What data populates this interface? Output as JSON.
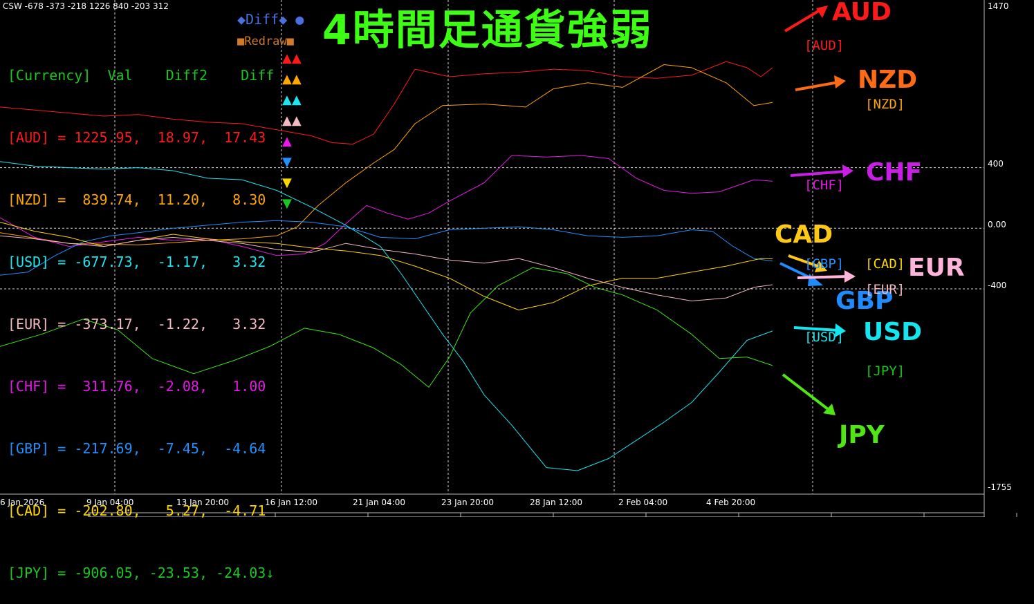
{
  "header": {
    "text": "CSW -678 -373 -218 1226 840 -203 312"
  },
  "title": "4時間足通貨強弱",
  "table": {
    "header": "[Currency]  Val    Diff2    Diff",
    "header_color": "#19c81e",
    "rows": [
      {
        "text": "[AUD] = 1225.95,  18.97,  17.43",
        "color": "#ff1a1a",
        "tri": "▲▲",
        "tri_color": "#ff1a1a"
      },
      {
        "text": "[NZD] =  839.74,  11.20,   8.30",
        "color": "#ffa500",
        "tri": "▲▲",
        "tri_color": "#ffa500"
      },
      {
        "text": "[USD] = -677.73,  -1.17,   3.32",
        "color": "#1ee6f0",
        "tri": "▲▲",
        "tri_color": "#1ee6f0"
      },
      {
        "text": "[EUR] = -373.17,  -1.22,   3.32",
        "color": "#f5b9c0",
        "tri": "▲▲",
        "tri_color": "#f5b9c0"
      },
      {
        "text": "[CHF] =  311.76,  -2.08,   1.00",
        "color": "#e619e6",
        "tri": "▲",
        "tri_color": "#e619e6"
      },
      {
        "text": "[GBP] = -217.69,  -7.45,  -4.64",
        "color": "#1e90ff",
        "tri": "▼",
        "tri_color": "#1e90ff"
      },
      {
        "text": "[CAD] = -202.80,   5.27,  -4.71",
        "color": "#ffd700",
        "tri": "▼",
        "tri_color": "#ffd700"
      },
      {
        "text": "[JPY] = -906.05, -23.53, -24.03↓",
        "color": "#19c81e",
        "tri": "▼",
        "tri_color": "#19c81e"
      }
    ]
  },
  "buttons": {
    "diff": "◆Diff◆ ●",
    "redraw": "■Redraw■"
  },
  "labels": [
    {
      "name": "AUD",
      "color": "#ff1a1a"
    },
    {
      "name": "NZD",
      "color": "#ff6a14"
    },
    {
      "name": "CHF",
      "color": "#c81ee6"
    },
    {
      "name": "CAD",
      "color": "#ffc814"
    },
    {
      "name": "EUR",
      "color": "#ffb4dc"
    },
    {
      "name": "GBP",
      "color": "#1e8cff"
    },
    {
      "name": "USD",
      "color": "#14e6f0"
    },
    {
      "name": "JPY",
      "color": "#50e614"
    }
  ],
  "tags": [
    "[AUD]",
    "[NZD]",
    "[CHF]",
    "[GBP]",
    "[CAD]",
    "[EUR]",
    "[USD]",
    "[JPY]"
  ],
  "chart_data": {
    "type": "line",
    "ylim": [
      -1755,
      1470
    ],
    "y_ticks": [
      "1470",
      "400",
      "0.00",
      "-400",
      "-1755"
    ],
    "x_ticks": [
      "6 Jan 2026",
      "9 Jan 04:00",
      "13 Jan 20:00",
      "16 Jan 12:00",
      "21 Jan 04:00",
      "23 Jan 20:00",
      "28 Jan 12:00",
      "2 Feb 04:00",
      "4 Feb 20:00"
    ],
    "grid": true,
    "series": [
      {
        "name": "AUD",
        "color": "#ff1a1a",
        "x": [
          0,
          50,
          100,
          150,
          200,
          250,
          300,
          350,
          400,
          450,
          480,
          510,
          540,
          570,
          600,
          650,
          700,
          750,
          800,
          850,
          900,
          950,
          1000,
          1050,
          1080,
          1100,
          1117
        ],
        "y": [
          800,
          780,
          760,
          740,
          750,
          720,
          700,
          690,
          650,
          610,
          565,
          555,
          620,
          820,
          1050,
          1000,
          1020,
          1030,
          1050,
          1040,
          1000,
          990,
          1010,
          1100,
          1060,
          1000,
          1060
        ]
      },
      {
        "name": "NZD",
        "color": "#ffa500",
        "x": [
          0,
          100,
          200,
          300,
          350,
          400,
          430,
          460,
          500,
          540,
          570,
          600,
          640,
          700,
          760,
          800,
          850,
          900,
          960,
          1000,
          1050,
          1090,
          1117
        ],
        "y": [
          -30,
          -100,
          -110,
          -80,
          -70,
          -50,
          10,
          150,
          300,
          430,
          520,
          690,
          810,
          820,
          800,
          920,
          960,
          930,
          1080,
          1060,
          960,
          810,
          830
        ]
      },
      {
        "name": "CHF",
        "color": "#e619e6",
        "x": [
          0,
          50,
          100,
          150,
          200,
          250,
          300,
          350,
          400,
          440,
          470,
          500,
          530,
          560,
          590,
          620,
          650,
          700,
          740,
          790,
          840,
          880,
          920,
          960,
          1000,
          1040,
          1090,
          1117
        ],
        "y": [
          70,
          -60,
          -120,
          -90,
          -60,
          -80,
          -70,
          -120,
          -180,
          -170,
          -100,
          30,
          150,
          100,
          60,
          100,
          180,
          300,
          480,
          470,
          480,
          460,
          330,
          250,
          230,
          240,
          320,
          310
        ]
      },
      {
        "name": "GBP",
        "color": "#1e90ff",
        "x": [
          0,
          40,
          80,
          120,
          160,
          200,
          250,
          300,
          350,
          400,
          450,
          500,
          550,
          600,
          650,
          700,
          750,
          800,
          850,
          900,
          950,
          1000,
          1030,
          1060,
          1090,
          1117
        ],
        "y": [
          -310,
          -290,
          -180,
          -90,
          -50,
          -30,
          0,
          20,
          40,
          50,
          40,
          10,
          -60,
          -70,
          -10,
          0,
          10,
          -10,
          -50,
          -60,
          -50,
          -10,
          -20,
          -120,
          -200,
          -217
        ]
      },
      {
        "name": "CAD",
        "color": "#ffd700",
        "x": [
          0,
          50,
          100,
          150,
          200,
          250,
          300,
          350,
          400,
          450,
          500,
          550,
          600,
          650,
          700,
          750,
          800,
          850,
          900,
          950,
          1000,
          1050,
          1100,
          1117
        ],
        "y": [
          40,
          -20,
          -60,
          -120,
          -80,
          -40,
          -70,
          -90,
          -100,
          -130,
          -150,
          -180,
          -250,
          -330,
          -450,
          -540,
          -490,
          -380,
          -330,
          -330,
          -290,
          -250,
          -200,
          -202
        ]
      },
      {
        "name": "EUR",
        "color": "#f5b9c0",
        "x": [
          0,
          50,
          100,
          150,
          200,
          250,
          300,
          350,
          400,
          450,
          500,
          550,
          600,
          650,
          700,
          750,
          800,
          850,
          900,
          950,
          1000,
          1050,
          1090,
          1117
        ],
        "y": [
          -50,
          -70,
          -100,
          -120,
          -80,
          -60,
          -80,
          -100,
          -140,
          -160,
          -100,
          -140,
          -170,
          -210,
          -230,
          -200,
          -260,
          -330,
          -390,
          -440,
          -480,
          -460,
          -390,
          -373
        ]
      },
      {
        "name": "USD",
        "color": "#1ee6f0",
        "x": [
          0,
          50,
          100,
          150,
          200,
          250,
          300,
          350,
          400,
          450,
          500,
          550,
          580,
          610,
          640,
          670,
          700,
          740,
          790,
          835,
          880,
          920,
          960,
          1000,
          1040,
          1080,
          1117
        ],
        "y": [
          440,
          410,
          400,
          390,
          400,
          380,
          330,
          320,
          250,
          140,
          20,
          -120,
          -300,
          -500,
          -700,
          -880,
          -1100,
          -1300,
          -1580,
          -1600,
          -1520,
          -1400,
          -1280,
          -1150,
          -950,
          -740,
          -678
        ]
      },
      {
        "name": "JPY",
        "color": "#3ce614",
        "x": [
          0,
          60,
          120,
          170,
          220,
          280,
          340,
          390,
          440,
          490,
          540,
          580,
          620,
          650,
          680,
          720,
          770,
          820,
          860,
          900,
          950,
          1000,
          1040,
          1080,
          1117
        ],
        "y": [
          -780,
          -700,
          -600,
          -670,
          -860,
          -960,
          -870,
          -780,
          -660,
          -700,
          -790,
          -900,
          -1050,
          -850,
          -560,
          -380,
          -260,
          -300,
          -390,
          -440,
          -540,
          -700,
          -860,
          -850,
          -906
        ]
      }
    ]
  }
}
